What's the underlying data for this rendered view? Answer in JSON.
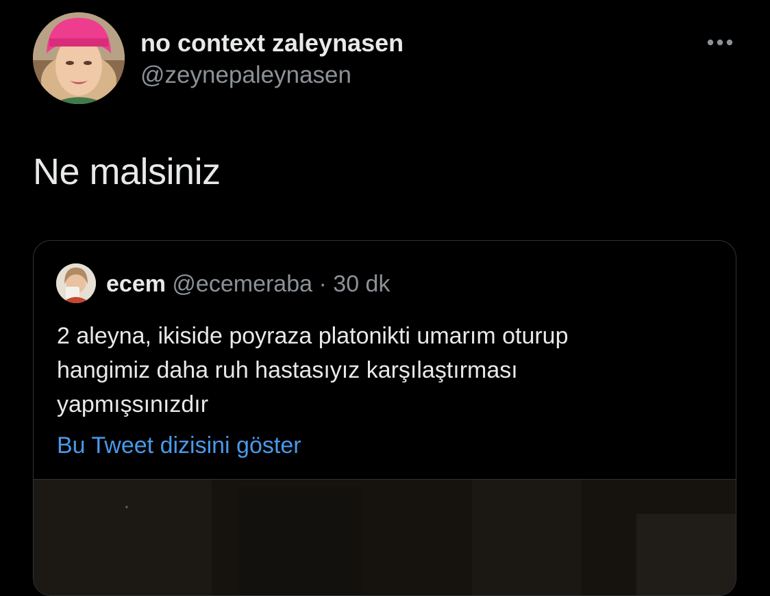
{
  "tweet": {
    "author": {
      "display_name": "no context zaleynasen",
      "handle": "@zeynepaleynasen",
      "avatar_icon": "profile-photo"
    },
    "more_icon": "ellipsis-icon",
    "text": "Ne malsiniz",
    "quote": {
      "author": {
        "display_name": "ecem",
        "handle": "@ecemeraba",
        "separator": "·",
        "time": "30 dk",
        "avatar_icon": "profile-photo"
      },
      "text_lines": [
        "2 aleyna, ikiside poyraza platonikti umarım oturup",
        "hangimiz daha ruh hastasıyız karşılaştırması",
        "yapmışsınızdır"
      ],
      "thread_link": "Bu Tweet dizisini göster",
      "media_icon": "photo-thumbnail"
    }
  },
  "colors": {
    "background": "#000000",
    "primary_text": "#e7e9ea",
    "secondary_text": "#8b9197",
    "link": "#4a99e9",
    "border": "#2f3336"
  }
}
